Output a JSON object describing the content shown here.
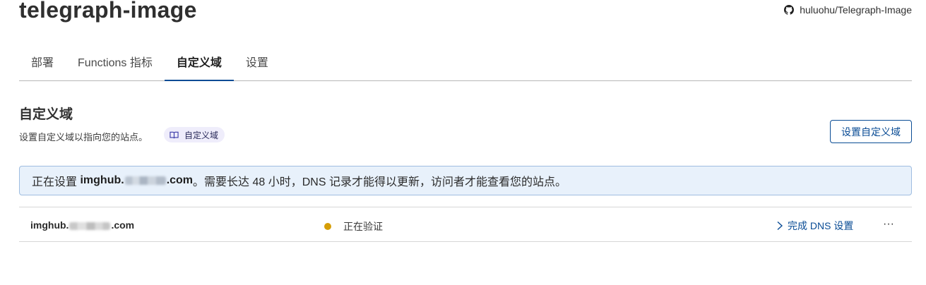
{
  "header": {
    "title": "telegraph-image",
    "repo": "huluohu/Telegraph-Image"
  },
  "tabs": [
    {
      "label": "部署"
    },
    {
      "label": "Functions 指标"
    },
    {
      "label": "自定义域",
      "active": true
    },
    {
      "label": "设置"
    }
  ],
  "section": {
    "title": "自定义域",
    "description": "设置自定义域以指向您的站点。",
    "doc_badge": "自定义域",
    "setup_button": "设置自定义域"
  },
  "banner": {
    "prefix": "正在设置",
    "domain_start": "imghub.",
    "domain_end": ".com",
    "message": "。需要长达 48 小时，DNS 记录才能得以更新，访问者才能查看您的站点。"
  },
  "domains": [
    {
      "name_start": "imghub.",
      "name_end": ".com",
      "status": "正在验证",
      "action": "完成 DNS 设置",
      "more": "···"
    }
  ],
  "colors": {
    "accent": "#0a4c95",
    "status_pending": "#d69e07",
    "banner_bg": "#e8f1fb"
  },
  "icons": {
    "repo": "github-icon",
    "doc": "book-icon",
    "action": "chevron-right-icon"
  }
}
